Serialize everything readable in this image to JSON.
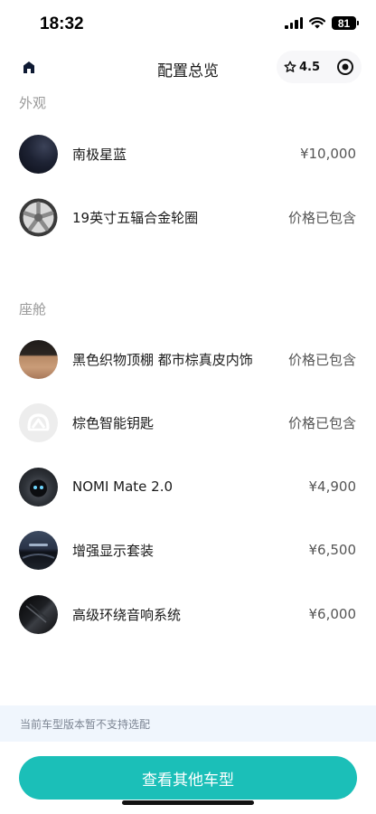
{
  "status": {
    "time": "18:32",
    "battery": "81"
  },
  "header": {
    "title": "配置总览",
    "rating": "4.5"
  },
  "sections": [
    {
      "label": "外观"
    },
    {
      "label": "座舱"
    }
  ],
  "exterior_items": [
    {
      "name": "南极星蓝",
      "price": "¥10,000",
      "icon": "paint-swatch-dark-blue"
    },
    {
      "name": "19英寸五辐合金轮圈",
      "price": "价格已包含",
      "icon": "alloy-wheel"
    }
  ],
  "cabin_items": [
    {
      "name": "黑色织物顶棚 都市棕真皮内饰",
      "price": "价格已包含",
      "icon": "interior-swatch-black-brown"
    },
    {
      "name": "棕色智能钥匙",
      "price": "价格已包含",
      "icon": "smart-key"
    },
    {
      "name": "NOMI Mate 2.0",
      "price": "¥4,900",
      "icon": "nomi-mate"
    },
    {
      "name": "增强显示套装",
      "price": "¥6,500",
      "icon": "display-package"
    },
    {
      "name": "高级环绕音响系统",
      "price": "¥6,000",
      "icon": "audio-system"
    }
  ],
  "notice": "当前车型版本暂不支持选配",
  "cta_label": "查看其他车型",
  "colors": {
    "accent": "#1bbfb8",
    "notice_bg": "#f0f6fd"
  }
}
